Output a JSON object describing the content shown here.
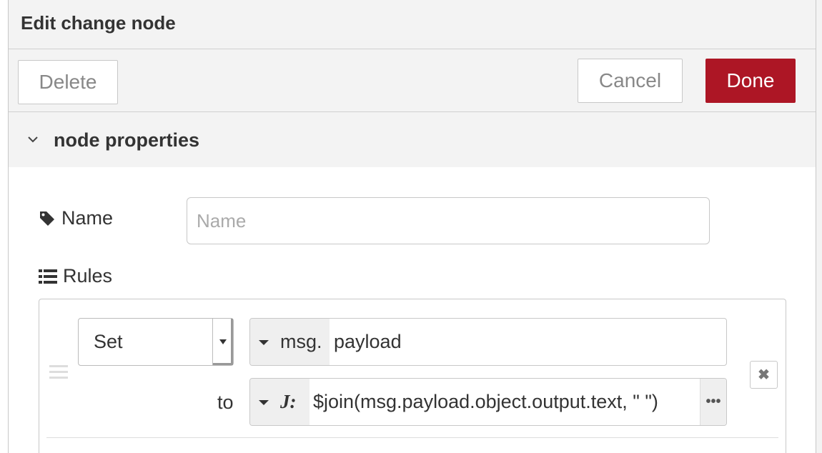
{
  "header": {
    "title": "Edit change node"
  },
  "toolbar": {
    "delete_label": "Delete",
    "cancel_label": "Cancel",
    "done_label": "Done"
  },
  "section": {
    "title": "node properties"
  },
  "form": {
    "name_label": "Name",
    "name_placeholder": "Name",
    "name_value": "",
    "rules_label": "Rules"
  },
  "rule": {
    "action": "Set",
    "property_type": "msg.",
    "property_value": "payload",
    "to_label": "to",
    "to_type_icon": "jsonata-icon",
    "to_type_glyph": "J:",
    "to_value": "$join(msg.payload.object.output.text, \" \")",
    "expand_glyph": "•••",
    "delete_glyph": "✖"
  },
  "colors": {
    "done_button": "#ad1625",
    "panel_bg": "#f3f3f3",
    "border": "#c8c8c8"
  }
}
